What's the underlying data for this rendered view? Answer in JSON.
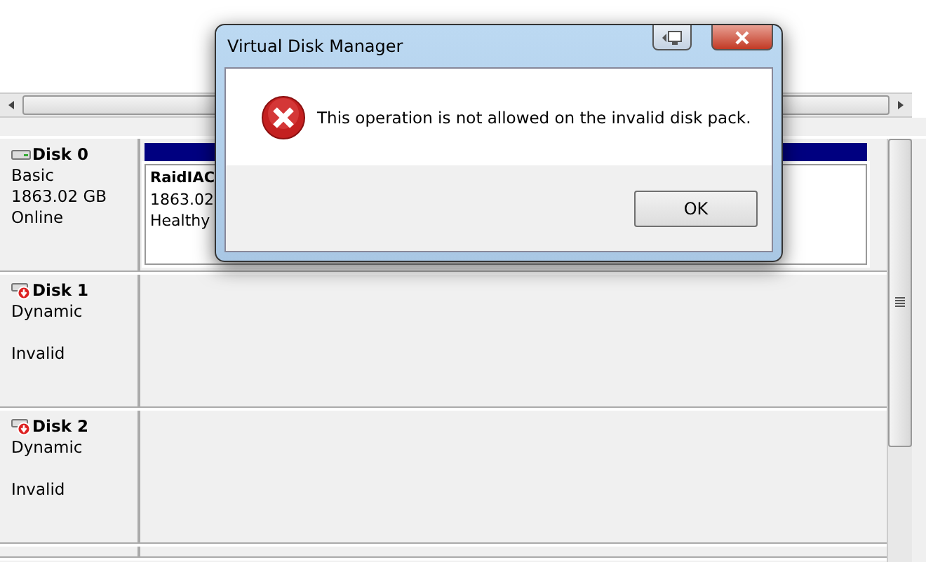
{
  "disks": [
    {
      "name": "Disk 0",
      "kind": "basic",
      "type": "Basic",
      "size": "1863.02 GB",
      "status": "Online",
      "partition": {
        "name": "RaidIAC",
        "size": "1863.02",
        "status": "Healthy"
      }
    },
    {
      "name": "Disk 1",
      "kind": "invalid",
      "type": "Dynamic",
      "status": "Invalid"
    },
    {
      "name": "Disk 2",
      "kind": "invalid",
      "type": "Dynamic",
      "status": "Invalid"
    }
  ],
  "dialog": {
    "title": "Virtual Disk Manager",
    "message": "This operation is not allowed on the invalid disk pack.",
    "button": "OK"
  }
}
